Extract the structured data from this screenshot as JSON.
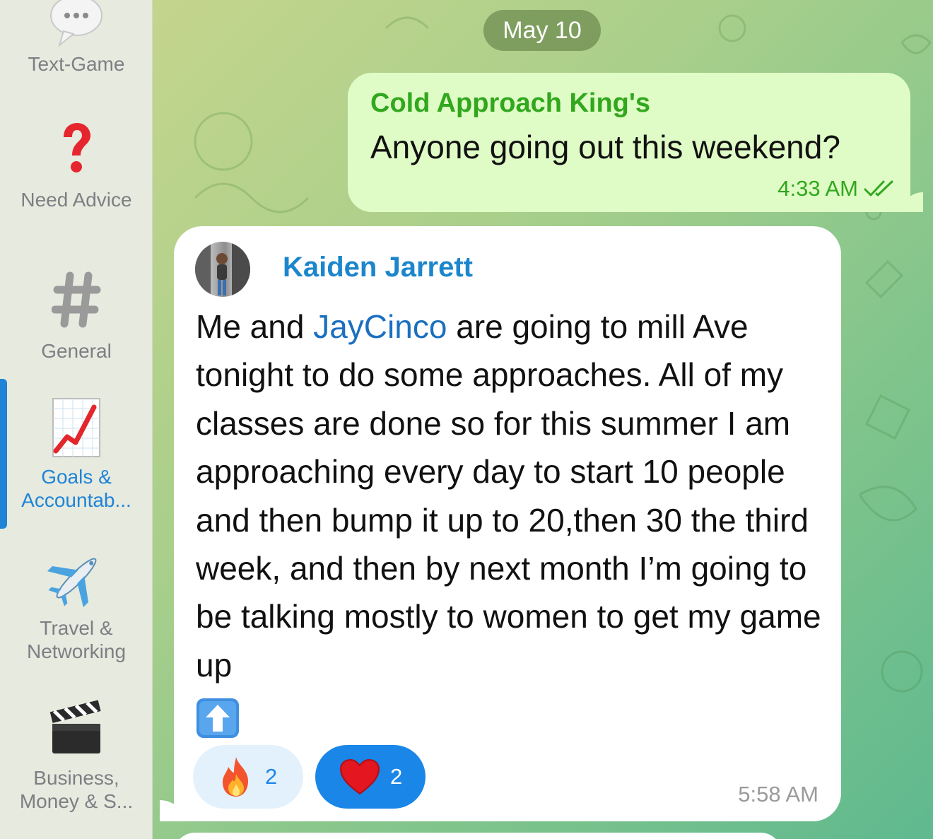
{
  "sidebar": {
    "folders": [
      {
        "label": "Text-Game",
        "icon": "speech-bubble-icon"
      },
      {
        "label": "Need Advice",
        "icon": "question-mark-icon"
      },
      {
        "label": "General",
        "icon": "hashtag-icon"
      },
      {
        "label": "Goals & Accountab...",
        "icon": "chart-increasing-icon",
        "active": true
      },
      {
        "label": "Travel & Networking",
        "icon": "airplane-icon"
      },
      {
        "label": "Business, Money & S...",
        "icon": "clapper-board-icon"
      }
    ]
  },
  "chat": {
    "date_separator": "May 10",
    "outgoing": {
      "sender": "Cold Approach King's",
      "text": "Anyone going out this weekend?",
      "time": "4:33 AM",
      "status_icon": "double-check-icon"
    },
    "incoming": {
      "sender": "Kaiden Jarrett",
      "text_part1": "Me and ",
      "mention": "JayCinco",
      "text_part2": " are going to mill Ave tonight to do some approaches. All of my classes are done so for this summer I am approaching every day to start 10 people and then bump it up to 20,then 30 the third week, and then by next month I’m going to be talking mostly to women to get my game up",
      "trailing_emoji": "up-arrow-icon",
      "reactions": [
        {
          "emoji": "fire-icon",
          "count": "2"
        },
        {
          "emoji": "heart-icon",
          "count": "2"
        }
      ],
      "time": "5:58 AM"
    }
  },
  "colors": {
    "accent_blue": "#1f84d6",
    "outgoing_bubble": "#e0fcc6",
    "outgoing_name": "#31a71e",
    "incoming_name": "#1c86cc"
  }
}
